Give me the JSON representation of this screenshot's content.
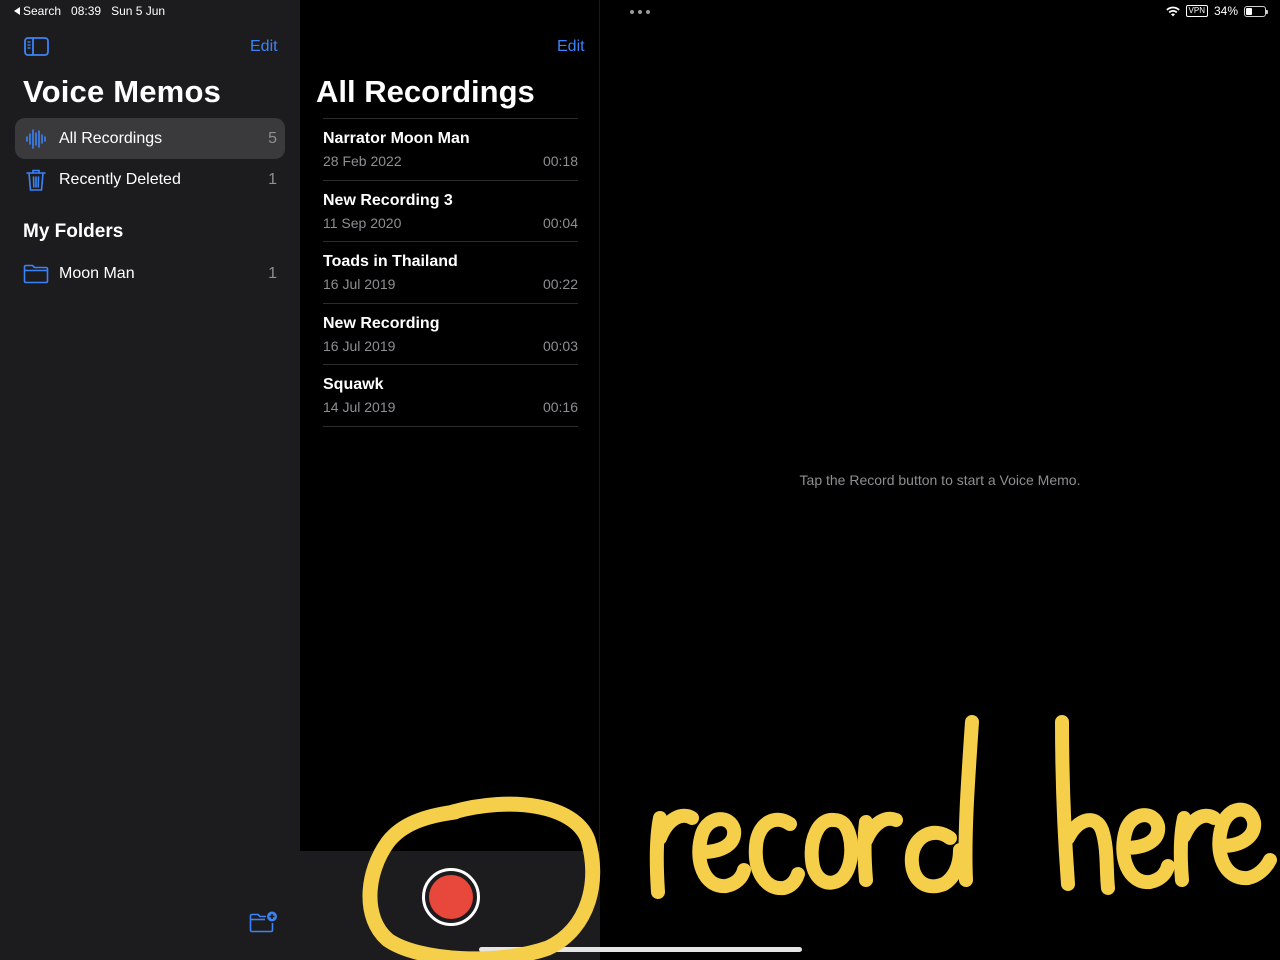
{
  "status_bar": {
    "back_label": "Search",
    "time": "08:39",
    "date": "Sun 5 Jun",
    "vpn": "VPN",
    "battery": "34%",
    "battery_level": 0.34
  },
  "sidebar": {
    "edit_label": "Edit",
    "title": "Voice Memos",
    "items": [
      {
        "label": "All Recordings",
        "count": "5",
        "icon": "waveform-icon"
      },
      {
        "label": "Recently Deleted",
        "count": "1",
        "icon": "trash-icon"
      }
    ],
    "folders_title": "My Folders",
    "folders": [
      {
        "label": "Moon Man",
        "count": "1",
        "icon": "folder-icon"
      }
    ]
  },
  "list": {
    "edit_label": "Edit",
    "title": "All Recordings",
    "recordings": [
      {
        "name": "Narrator Moon Man",
        "date": "28 Feb 2022",
        "duration": "00:18"
      },
      {
        "name": "New Recording 3",
        "date": "11 Sep 2020",
        "duration": "00:04"
      },
      {
        "name": "Toads in Thailand",
        "date": "16 Jul 2019",
        "duration": "00:22"
      },
      {
        "name": "New Recording",
        "date": "16 Jul 2019",
        "duration": "00:03"
      },
      {
        "name": "Squawk",
        "date": "14 Jul 2019",
        "duration": "00:16"
      }
    ]
  },
  "detail": {
    "empty_message": "Tap the Record button to start a Voice Memo."
  },
  "annotation": {
    "text": "record here",
    "color": "#f5cf4a"
  },
  "colors": {
    "accent": "#3b82f6",
    "record": "#e8473c",
    "sidebar_bg": "#1c1c1e"
  }
}
